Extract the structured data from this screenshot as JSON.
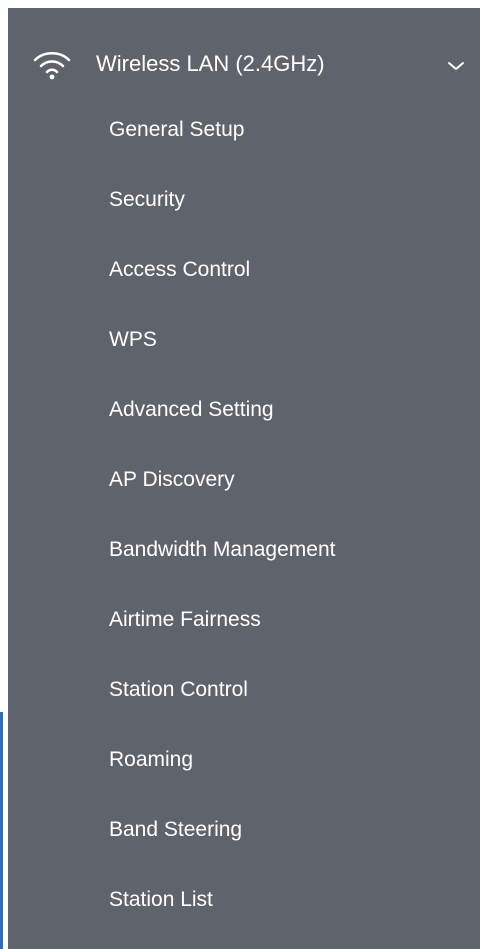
{
  "sidebar": {
    "section": {
      "label": "Wireless LAN (2.4GHz)",
      "icon": "wifi-icon",
      "expanded_icon": "chevron-down-icon"
    },
    "items": [
      {
        "label": "General Setup"
      },
      {
        "label": "Security"
      },
      {
        "label": "Access Control"
      },
      {
        "label": "WPS"
      },
      {
        "label": "Advanced Setting"
      },
      {
        "label": "AP Discovery"
      },
      {
        "label": "Bandwidth Management"
      },
      {
        "label": "Airtime Fairness"
      },
      {
        "label": "Station Control"
      },
      {
        "label": "Roaming"
      },
      {
        "label": "Band Steering"
      },
      {
        "label": "Station List"
      }
    ]
  },
  "colors": {
    "sidebar_bg": "#5f646c",
    "text": "#ffffff",
    "edge_accent": "#2a6fc4"
  }
}
